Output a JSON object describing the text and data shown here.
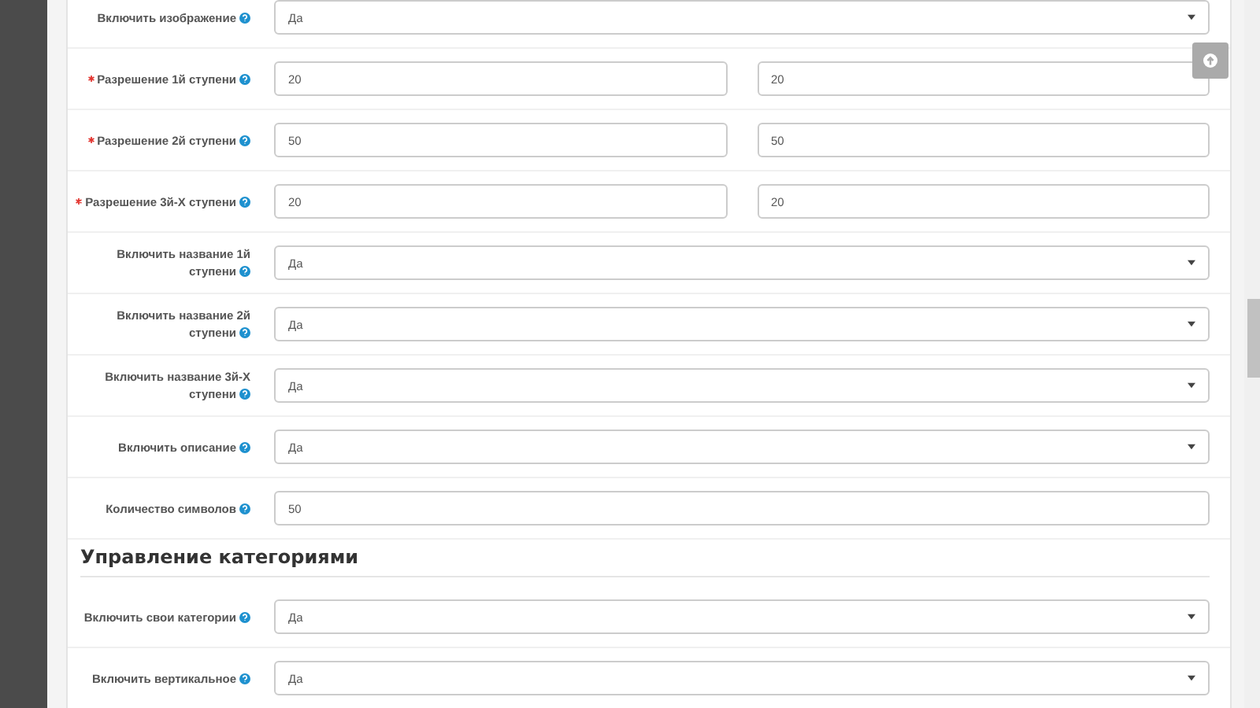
{
  "rows": [
    {
      "label": "Включить изображение",
      "required": false,
      "kind": "select",
      "values": [
        "Да"
      ]
    },
    {
      "label": "Разрешение 1й ступени",
      "required": true,
      "kind": "pair",
      "values": [
        "20",
        "20"
      ]
    },
    {
      "label": "Разрешение 2й ступени",
      "required": true,
      "kind": "pair",
      "values": [
        "50",
        "50"
      ]
    },
    {
      "label": "Разрешение 3й-Х ступени",
      "required": true,
      "kind": "pair",
      "values": [
        "20",
        "20"
      ]
    },
    {
      "label": "Включить название 1й ступени",
      "required": false,
      "kind": "select",
      "values": [
        "Да"
      ]
    },
    {
      "label": "Включить название 2й ступени",
      "required": false,
      "kind": "select",
      "values": [
        "Да"
      ]
    },
    {
      "label": "Включить название 3й-Х ступени",
      "required": false,
      "kind": "select",
      "values": [
        "Да"
      ]
    },
    {
      "label": "Включить описание",
      "required": false,
      "kind": "select",
      "values": [
        "Да"
      ]
    },
    {
      "label": "Количество символов",
      "required": false,
      "kind": "input",
      "values": [
        "50"
      ]
    }
  ],
  "section": {
    "heading": "Управление категориями",
    "rows": [
      {
        "label": "Включить свои категории",
        "required": false,
        "kind": "select",
        "values": [
          "Да"
        ]
      },
      {
        "label": "Включить вертикальное",
        "required": false,
        "kind": "select",
        "values": [
          "Да"
        ]
      }
    ]
  }
}
